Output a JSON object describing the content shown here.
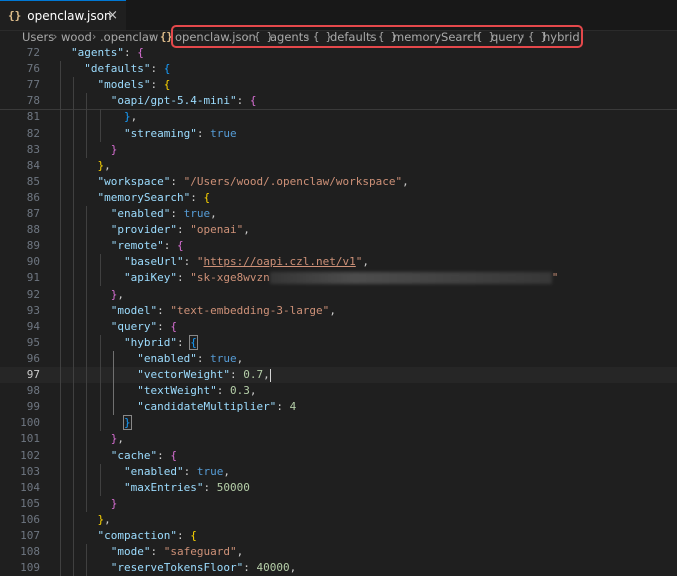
{
  "tab": {
    "icon": "{}",
    "title": "openclaw.json",
    "close": "×"
  },
  "breadcrumb": {
    "path": [
      "Users",
      "wood",
      ".openclaw"
    ],
    "file_icon": "{}",
    "file": "openclaw.json",
    "obj_icon": "{ }",
    "symbols": [
      "agents",
      "defaults",
      "memorySearch",
      "query",
      "hybrid"
    ],
    "separator": "›"
  },
  "editor": {
    "lines": [
      {
        "n": "72",
        "html": "<span class='k'>\"agents\"</span><span class='p'>: </span><span class='br2'>{</span>"
      },
      {
        "n": "76",
        "html": "  <span class='k'>\"defaults\"</span><span class='p'>: </span><span class='br3'>{</span>"
      },
      {
        "n": "77",
        "html": "    <span class='k'>\"models\"</span><span class='p'>: </span><span class='br1'>{</span>"
      },
      {
        "n": "78",
        "html": "      <span class='k'>\"oapi/gpt-5.4-mini\"</span><span class='p'>: </span><span class='br2'>{</span>"
      },
      {
        "n": "81",
        "html": "        <span class='br3'>}</span><span class='p'>,</span>"
      },
      {
        "n": "82",
        "html": "        <span class='k'>\"streaming\"</span><span class='p'>: </span><span class='b'>true</span>"
      },
      {
        "n": "83",
        "html": "      <span class='br2'>}</span>"
      },
      {
        "n": "84",
        "html": "    <span class='br1'>}</span><span class='p'>,</span>"
      },
      {
        "n": "85",
        "html": "    <span class='k'>\"workspace\"</span><span class='p'>: </span><span class='s'>\"/Users/wood/.openclaw/workspace\"</span><span class='p'>,</span>"
      },
      {
        "n": "86",
        "html": "    <span class='k'>\"memorySearch\"</span><span class='p'>: </span><span class='br1'>{</span>"
      },
      {
        "n": "87",
        "html": "      <span class='k'>\"enabled\"</span><span class='p'>: </span><span class='b'>true</span><span class='p'>,</span>"
      },
      {
        "n": "88",
        "html": "      <span class='k'>\"provider\"</span><span class='p'>: </span><span class='s'>\"openai\"</span><span class='p'>,</span>"
      },
      {
        "n": "89",
        "html": "      <span class='k'>\"remote\"</span><span class='p'>: </span><span class='br2'>{</span>"
      },
      {
        "n": "90",
        "html": "        <span class='k'>\"baseUrl\"</span><span class='p'>: </span><span class='s'>\"</span><span class='url'>https://oapi.czl.net/v1</span><span class='s'>\"</span><span class='p'>,</span>"
      },
      {
        "n": "91",
        "html": "        <span class='k'>\"apiKey\"</span><span class='p'>: </span><span class='s'>\"sk-xge8wvzn</span><span class='blur' data-name='redacted-key-blur'></span><span class='s'>\"</span>"
      },
      {
        "n": "92",
        "html": "      <span class='br2'>}</span><span class='p'>,</span>"
      },
      {
        "n": "93",
        "html": "      <span class='k'>\"model\"</span><span class='p'>: </span><span class='s'>\"text-embedding-3-large\"</span><span class='p'>,</span>"
      },
      {
        "n": "94",
        "html": "      <span class='k'>\"query\"</span><span class='p'>: </span><span class='br2'>{</span>"
      },
      {
        "n": "95",
        "html": "        <span class='k'>\"hybrid\"</span><span class='p'>: </span><span class='br3 bracket-box'>{</span>"
      },
      {
        "n": "96",
        "html": "          <span class='k'>\"enabled\"</span><span class='p'>: </span><span class='b'>true</span><span class='p'>,</span>"
      },
      {
        "n": "97",
        "html": "          <span class='k'>\"vectorWeight\"</span><span class='p'>: </span><span class='n'>0.7</span><span class='p'>,</span><span class='cursor'></span>",
        "current": true
      },
      {
        "n": "98",
        "html": "          <span class='k'>\"textWeight\"</span><span class='p'>: </span><span class='n'>0.3</span><span class='p'>,</span>"
      },
      {
        "n": "99",
        "html": "          <span class='k'>\"candidateMultiplier\"</span><span class='p'>: </span><span class='n'>4</span>"
      },
      {
        "n": "100",
        "html": "        <span class='br3 bracket-box'>}</span>"
      },
      {
        "n": "101",
        "html": "      <span class='br2'>}</span><span class='p'>,</span>"
      },
      {
        "n": "102",
        "html": "      <span class='k'>\"cache\"</span><span class='p'>: </span><span class='br2'>{</span>"
      },
      {
        "n": "103",
        "html": "        <span class='k'>\"enabled\"</span><span class='p'>: </span><span class='b'>true</span><span class='p'>,</span>"
      },
      {
        "n": "104",
        "html": "        <span class='k'>\"maxEntries\"</span><span class='p'>: </span><span class='n'>50000</span>"
      },
      {
        "n": "105",
        "html": "      <span class='br2'>}</span>"
      },
      {
        "n": "106",
        "html": "    <span class='br1'>}</span><span class='p'>,</span>"
      },
      {
        "n": "107",
        "html": "    <span class='k'>\"compaction\"</span><span class='p'>: </span><span class='br1'>{</span>"
      },
      {
        "n": "108",
        "html": "      <span class='k'>\"mode\"</span><span class='p'>: </span><span class='s'>\"safeguard\"</span><span class='p'>,</span>"
      },
      {
        "n": "109",
        "html": "      <span class='k'>\"reserveTokensFloor\"</span><span class='p'>: </span><span class='n'>40000</span><span class='p'>,</span>"
      }
    ]
  },
  "colors": {
    "editor_bg": "#1f1f1f",
    "highlight_box": "#e4484b",
    "key": "#9cdcfe",
    "string": "#ce9178",
    "number": "#b5cea8",
    "boolean": "#569cd6"
  }
}
